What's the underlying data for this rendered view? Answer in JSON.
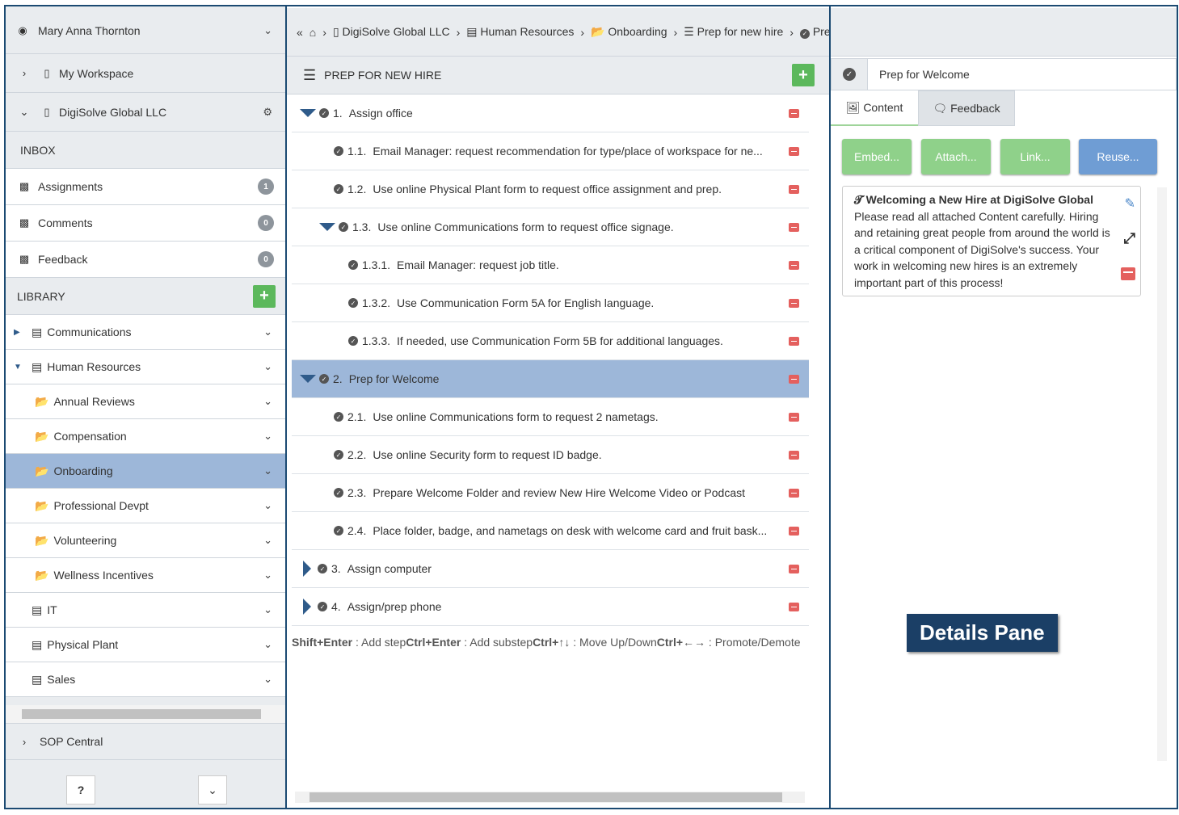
{
  "sidebar": {
    "user": "Mary Anna Thornton",
    "workspace": "My Workspace",
    "org": "DigiSolve Global LLC",
    "inbox_label": "INBOX",
    "inbox": [
      {
        "label": "Assignments",
        "count": "1"
      },
      {
        "label": "Comments",
        "count": "0"
      },
      {
        "label": "Feedback",
        "count": "0"
      }
    ],
    "library_label": "LIBRARY",
    "library": [
      {
        "label": "Communications",
        "level": 0,
        "expanded": false
      },
      {
        "label": "Human Resources",
        "level": 0,
        "expanded": true
      },
      {
        "label": "Annual Reviews",
        "level": 1
      },
      {
        "label": "Compensation",
        "level": 1
      },
      {
        "label": "Onboarding",
        "level": 1,
        "selected": true
      },
      {
        "label": "Professional Devpt",
        "level": 1
      },
      {
        "label": "Volunteering",
        "level": 1
      },
      {
        "label": "Wellness Incentives",
        "level": 1
      },
      {
        "label": "IT",
        "level": 0
      },
      {
        "label": "Physical Plant",
        "level": 0
      },
      {
        "label": "Sales",
        "level": 0
      }
    ],
    "sop_central": "SOP Central"
  },
  "breadcrumb": [
    "DigiSolve Global LLC",
    "Human Resources",
    "Onboarding",
    "Prep for new hire",
    "Prep for Welcome"
  ],
  "procedure": {
    "title": "PREP FOR NEW HIRE",
    "steps": [
      {
        "num": "1.",
        "text": "Assign office",
        "level": 0,
        "toggle": "down"
      },
      {
        "num": "1.1.",
        "text": "Email Manager: request recommendation for type/place of workspace for ne...",
        "level": 1
      },
      {
        "num": "1.2.",
        "text": "Use online Physical Plant form to request office assignment and prep.",
        "level": 1
      },
      {
        "num": "1.3.",
        "text": "Use online Communications form to request office signage.",
        "level": 1,
        "toggle": "down"
      },
      {
        "num": "1.3.1.",
        "text": "Email Manager: request job title.",
        "level": 2
      },
      {
        "num": "1.3.2.",
        "text": "Use Communication Form 5A for English language.",
        "level": 2
      },
      {
        "num": "1.3.3.",
        "text": "If needed, use Communication Form 5B for additional languages.",
        "level": 2
      },
      {
        "num": "2.",
        "text": "Prep for Welcome",
        "level": 0,
        "toggle": "down",
        "selected": true
      },
      {
        "num": "2.1.",
        "text": "Use online Communications form to request 2 nametags.",
        "level": 1
      },
      {
        "num": "2.2.",
        "text": "Use online Security form to request ID badge.",
        "level": 1
      },
      {
        "num": "2.3.",
        "text": "Prepare Welcome Folder and review New Hire Welcome Video or Podcast",
        "level": 1
      },
      {
        "num": "2.4.",
        "text": "Place folder, badge, and nametags on desk with welcome card and fruit bask...",
        "level": 1
      },
      {
        "num": "3.",
        "text": "Assign computer",
        "level": 0,
        "toggle": "right"
      },
      {
        "num": "4.",
        "text": "Assign/prep phone",
        "level": 0,
        "toggle": "right"
      }
    ],
    "hints": [
      {
        "key": "Shift+Enter",
        "desc": " : Add step"
      },
      {
        "key": "Ctrl+Enter",
        "desc": " : Add substep"
      },
      {
        "key": "Ctrl+↑↓",
        "desc": " : Move Up/Down"
      },
      {
        "key": "Ctrl+←→",
        "desc": " : Promote/Demote"
      }
    ]
  },
  "details": {
    "title": "Prep for Welcome",
    "tabs": [
      "Content",
      "Feedback"
    ],
    "buttons": [
      {
        "label": "Embed...",
        "color": "#8fd18a"
      },
      {
        "label": "Attach...",
        "color": "#8fd18a"
      },
      {
        "label": "Link...",
        "color": "#8fd18a"
      },
      {
        "label": "Reuse...",
        "color": "#6f9dd4"
      }
    ],
    "card_title": "Welcoming a New Hire at DigiSolve Global",
    "card_body": "Please read all attached Content carefully. Hiring and retaining great people from around the world is a critical component of DigiSolve's success. Your work in welcoming new hires is an extremely important part of this process!",
    "pane_label": "Details Pane"
  }
}
